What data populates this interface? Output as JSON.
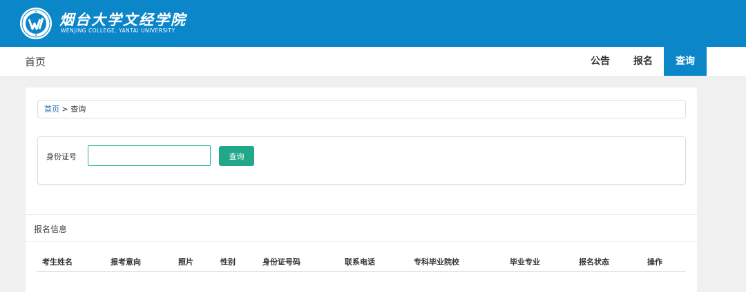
{
  "header": {
    "logo_cn": "烟台大学文经学院",
    "logo_en": "WENJING COLLEGE, YANTAI UNIVERSITY"
  },
  "nav": {
    "brand": "首页",
    "items": [
      {
        "label": "公告",
        "active": false
      },
      {
        "label": "报名",
        "active": false
      },
      {
        "label": "查询",
        "active": true
      }
    ]
  },
  "breadcrumb": {
    "home": "首页",
    "separator": ">",
    "current": "查询"
  },
  "search": {
    "label": "身份证号",
    "value": "",
    "button": "查询"
  },
  "registration": {
    "title": "报名信息",
    "columns": [
      "考生姓名",
      "报考意向",
      "照片",
      "性别",
      "身份证号码",
      "联系电话",
      "专科毕业院校",
      "毕业专业",
      "报名状态",
      "操作"
    ]
  },
  "colors": {
    "primary": "#0a86c9",
    "button": "#22a889",
    "input_border": "#26b594",
    "link": "#2b6fb0"
  },
  "icons": {
    "logo": "college-emblem-icon"
  }
}
